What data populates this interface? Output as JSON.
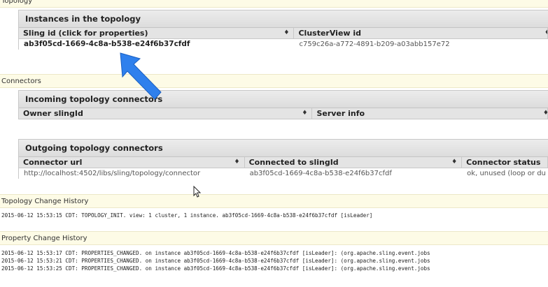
{
  "sections": {
    "topology": "Topology",
    "connectors": "Connectors",
    "topology_history": "Topology Change History",
    "property_history": "Property Change History"
  },
  "instances": {
    "title": "Instances in the topology",
    "headers": [
      "Sling id (click for properties)",
      "ClusterView id"
    ],
    "rows": [
      {
        "sling_id": "ab3f05cd-1669-4c8a-b538-e24f6b37cfdf",
        "clusterview_id": "c759c26a-a772-4891-b209-a03abb157e72"
      }
    ]
  },
  "incoming": {
    "title": "Incoming topology connectors",
    "headers": [
      "Owner slingId",
      "Server info"
    ]
  },
  "outgoing": {
    "title": "Outgoing topology connectors",
    "headers": [
      "Connector url",
      "Connected to slingId",
      "Connector status"
    ],
    "rows": [
      {
        "url": "http://localhost:4502/libs/sling/topology/connector",
        "slingid": "ab3f05cd-1669-4c8a-b538-e24f6b37cfdf",
        "status": "ok, unused (loop or du"
      }
    ]
  },
  "sort_glyph": "♦",
  "topology_log": [
    "2015-06-12 15:53:15 CDT: TOPOLOGY_INIT. view: 1 cluster, 1 instance. ab3f05cd-1669-4c8a-b538-e24f6b37cfdf [isLeader]"
  ],
  "property_log": [
    "2015-06-12 15:53:17 CDT: PROPERTIES_CHANGED. on instance ab3f05cd-1669-4c8a-b538-e24f6b37cfdf [isLeader]: (org.apache.sling.event.jobs",
    "2015-06-12 15:53:21 CDT: PROPERTIES_CHANGED. on instance ab3f05cd-1669-4c8a-b538-e24f6b37cfdf [isLeader]: (org.apache.sling.event.jobs",
    "2015-06-12 15:53:25 CDT: PROPERTIES_CHANGED. on instance ab3f05cd-1669-4c8a-b538-e24f6b37cfdf [isLeader]: (org.apache.sling.event.jobs"
  ],
  "colors": {
    "arrow": "#2f80ed",
    "section_bg": "#fdfbe6",
    "header_bg": "#e4e4e4"
  },
  "icons": {
    "annotation": "arrow-annotation-icon",
    "pointer": "mouse-pointer-icon"
  }
}
